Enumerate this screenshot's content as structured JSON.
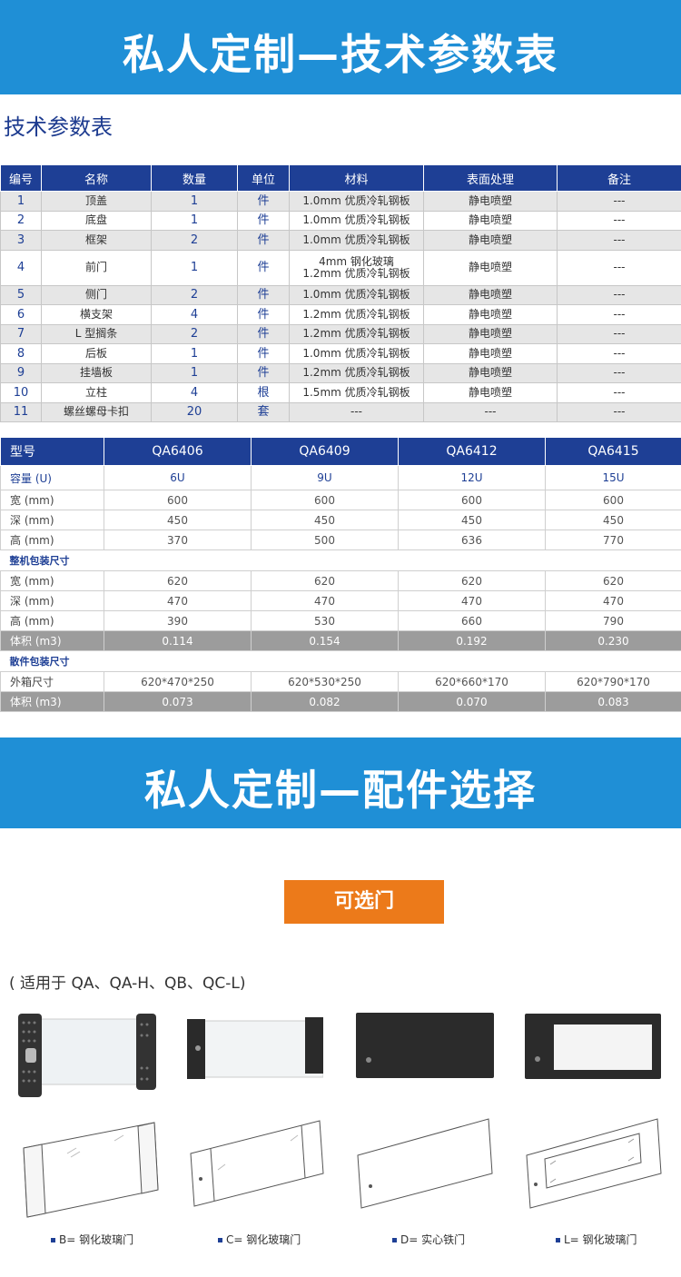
{
  "banner1": {
    "title": "私人定制—技术参数表"
  },
  "subtitle": "技术参数表",
  "spec_table": {
    "headers": [
      "编号",
      "名称",
      "数量",
      "单位",
      "材料",
      "表面处理",
      "备注"
    ],
    "rows": [
      [
        "1",
        "顶盖",
        "1",
        "件",
        "1.0mm 优质冷轧钢板",
        "静电喷塑",
        "---"
      ],
      [
        "2",
        "底盘",
        "1",
        "件",
        "1.0mm 优质冷轧钢板",
        "静电喷塑",
        "---"
      ],
      [
        "3",
        "框架",
        "2",
        "件",
        "1.0mm 优质冷轧钢板",
        "静电喷塑",
        "---"
      ],
      [
        "4",
        "前门",
        "1",
        "件",
        "4mm 钢化玻璃\n1.2mm 优质冷轧钢板",
        "静电喷塑",
        "---"
      ],
      [
        "5",
        "侧门",
        "2",
        "件",
        "1.0mm 优质冷轧钢板",
        "静电喷塑",
        "---"
      ],
      [
        "6",
        "横支架",
        "4",
        "件",
        "1.2mm 优质冷轧钢板",
        "静电喷塑",
        "---"
      ],
      [
        "7",
        "L 型搁条",
        "2",
        "件",
        "1.2mm 优质冷轧钢板",
        "静电喷塑",
        "---"
      ],
      [
        "8",
        "后板",
        "1",
        "件",
        "1.0mm 优质冷轧钢板",
        "静电喷塑",
        "---"
      ],
      [
        "9",
        "挂墙板",
        "1",
        "件",
        "1.2mm 优质冷轧钢板",
        "静电喷塑",
        "---"
      ],
      [
        "10",
        "立柱",
        "4",
        "根",
        "1.5mm 优质冷轧钢板",
        "静电喷塑",
        "---"
      ],
      [
        "11",
        "螺丝螺母卡扣",
        "20",
        "套",
        "---",
        "---",
        "---"
      ]
    ]
  },
  "model_table": {
    "header": [
      "型号",
      "QA6406",
      "QA6409",
      "QA6412",
      "QA6415"
    ],
    "capacity": [
      "容量 (U)",
      "6U",
      "9U",
      "12U",
      "15U"
    ],
    "dims": [
      [
        "宽 (mm)",
        "600",
        "600",
        "600",
        "600"
      ],
      [
        "深 (mm)",
        "450",
        "450",
        "450",
        "450"
      ],
      [
        "高 (mm)",
        "370",
        "500",
        "636",
        "770"
      ]
    ],
    "pack_title": "整机包装尺寸",
    "pack": [
      [
        "宽 (mm)",
        "620",
        "620",
        "620",
        "620"
      ],
      [
        "深 (mm)",
        "470",
        "470",
        "470",
        "470"
      ],
      [
        "高 (mm)",
        "390",
        "530",
        "660",
        "790"
      ]
    ],
    "pack_volume": [
      "体积 (m3)",
      "0.114",
      "0.154",
      "0.192",
      "0.230"
    ],
    "loose_title": "散件包装尺寸",
    "loose_box": [
      "外箱尺寸",
      "620*470*250",
      "620*530*250",
      "620*660*170",
      "620*790*170"
    ],
    "loose_volume": [
      "体积 (m3)",
      "0.073",
      "0.082",
      "0.070",
      "0.083"
    ]
  },
  "banner2": {
    "title": "私人定制—配件选择"
  },
  "optional_label": "可选门",
  "applies_to": "( 适用于 QA、QA-H、QB、QC-L)",
  "doors": [
    {
      "caption": "B= 钢化玻璃门",
      "icon": "perforated-glass-door-icon"
    },
    {
      "caption": "C= 钢化玻璃门",
      "icon": "glass-door-icon"
    },
    {
      "caption": "D= 实心铁门",
      "icon": "solid-door-icon"
    },
    {
      "caption": "L= 钢化玻璃门",
      "icon": "window-door-icon"
    }
  ],
  "colors": {
    "banner": "#1f8fd6",
    "header": "#1e3f95",
    "orange": "#ec7a1a"
  }
}
